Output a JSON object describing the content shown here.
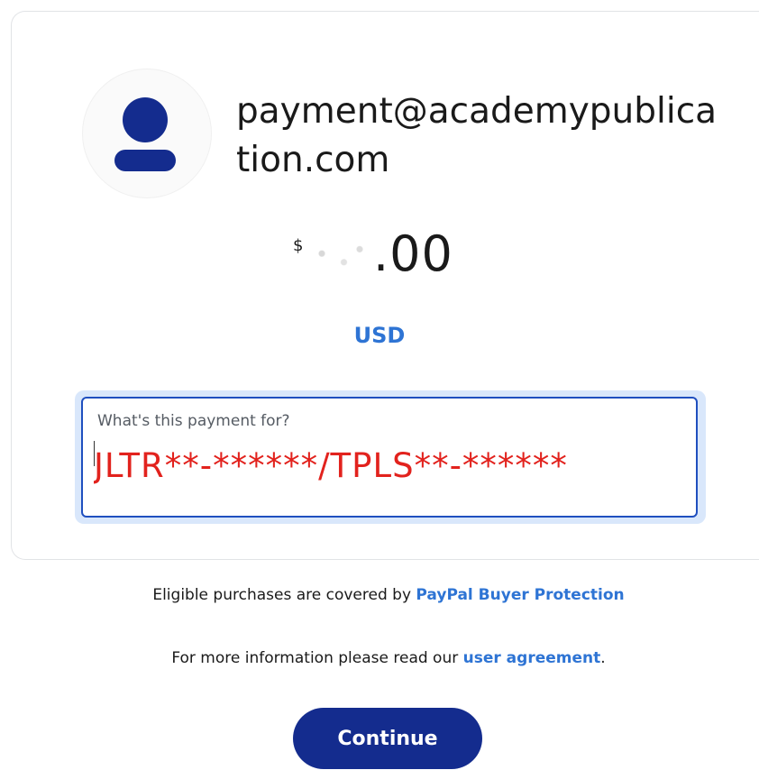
{
  "recipient": {
    "email": "payment@academypublication.com"
  },
  "payment": {
    "currency_symbol": "$",
    "amount_visible": ".00",
    "currency_code": "USD"
  },
  "note": {
    "label": "What's this payment for?",
    "value": "JLTR**-******/TPLS**-******"
  },
  "footer": {
    "protection_text": "Eligible purchases are covered by ",
    "protection_link": "PayPal Buyer Protection",
    "agreement_text": "For more information please read our ",
    "agreement_link": "user agreement",
    "agreement_end": "."
  },
  "actions": {
    "continue_label": "Continue"
  },
  "colors": {
    "brand_navy": "#142c8e",
    "link_blue": "#2e74d4",
    "note_red": "#e2221d"
  }
}
